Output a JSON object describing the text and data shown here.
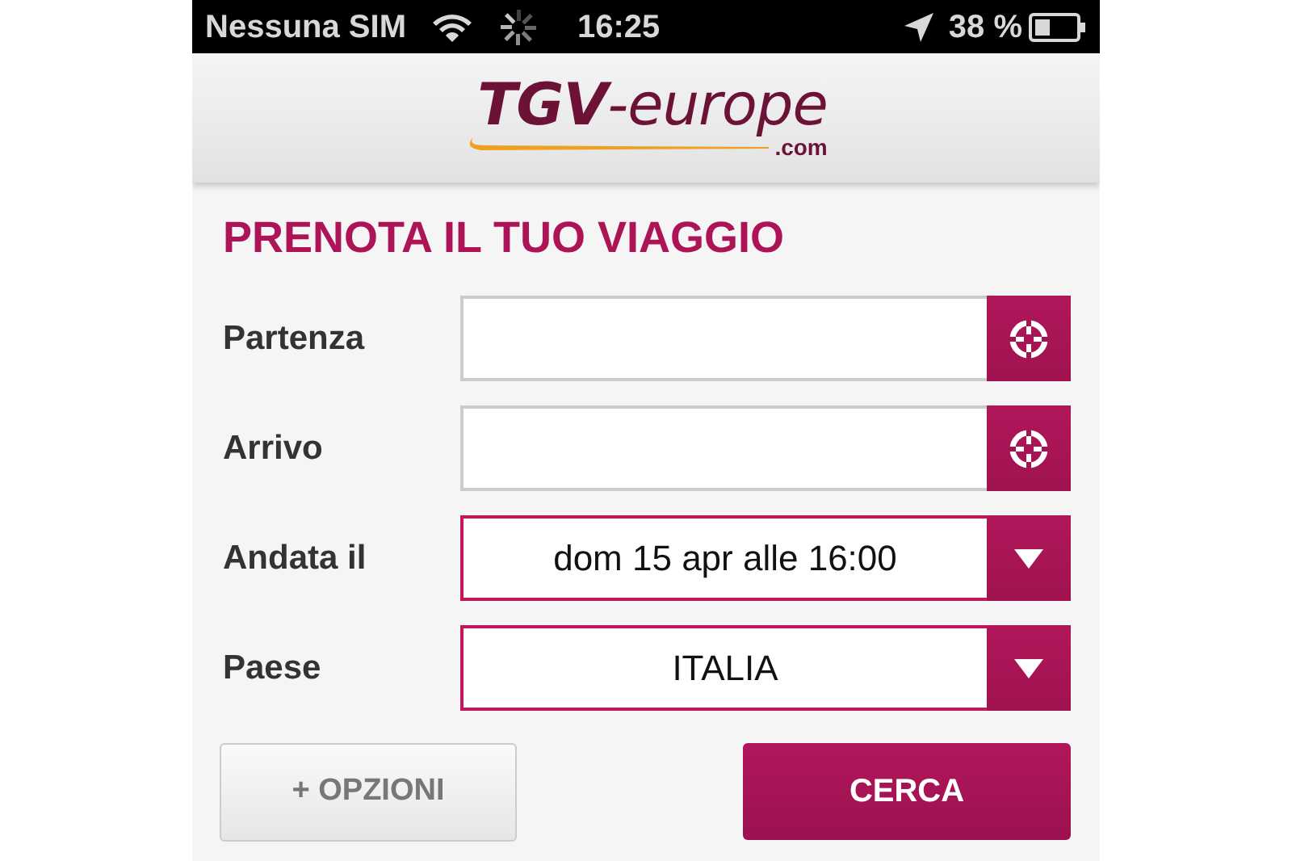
{
  "status_bar": {
    "carrier": "Nessuna SIM",
    "time": "16:25",
    "battery": "38 %"
  },
  "header": {
    "logo": "**TGV**-europe",
    "domain": ".com"
  },
  "form": {
    "title": "PRENOTA IL TUO VIAGGIO",
    "fields": [
      {
        "kind": "location",
        "label": "Partenza"
      },
      {
        "kind": "location",
        "label": "Arrivo"
      },
      {
        "kind": "select",
        "label": "Andata il",
        "value": "dom 15 apr alle 16:00"
      },
      {
        "kind": "select",
        "label": "Paese",
        "value": "ITALIA"
      }
    ],
    "buttons": [
      {
        "kind": "secondary",
        "label": "+ OPZIONI"
      },
      {
        "kind": "primary",
        "label": "CERCA"
      }
    ]
  }
}
